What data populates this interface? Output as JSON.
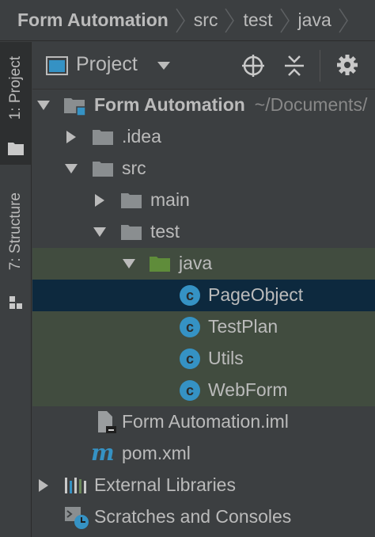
{
  "breadcrumb": {
    "items": [
      "Form Automation",
      "src",
      "test",
      "java"
    ]
  },
  "tool_strip": {
    "project_tab": "1: Project",
    "structure_tab": "7: Structure"
  },
  "panel": {
    "view_selector": "Project"
  },
  "tree": {
    "root_label": "Form Automation",
    "root_path": "~/Documents/",
    "idea": ".idea",
    "src": "src",
    "main": "main",
    "test": "test",
    "java": "java",
    "classes": [
      "PageObject",
      "TestPlan",
      "Utils",
      "WebForm"
    ],
    "iml": "Form Automation.iml",
    "pom": "pom.xml",
    "external_libraries": "External Libraries",
    "scratches": "Scratches and Consoles"
  },
  "colors": {
    "background": "#3c3f41",
    "selection": "#0d293e",
    "highlight": "#414c3f",
    "class_icon": "#3592c4",
    "folder": "#8a8e90",
    "source_folder": "#5f8c3a"
  }
}
